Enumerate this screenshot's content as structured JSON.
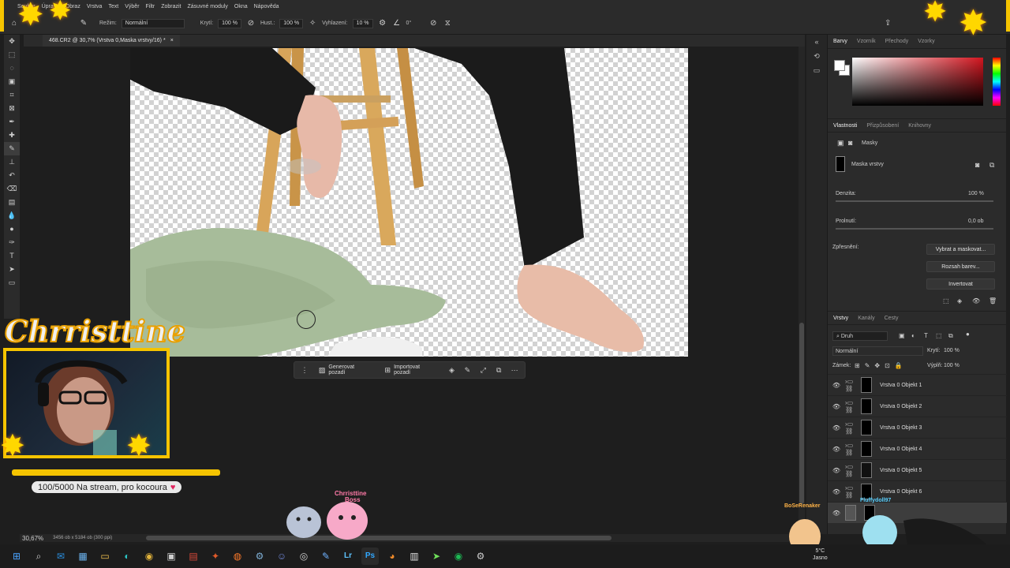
{
  "menu": [
    "Soubor",
    "Úpravy",
    "Obraz",
    "Vrstva",
    "Text",
    "Výběr",
    "Filtr",
    "Zobrazit",
    "Zásuvné moduly",
    "Okna",
    "Nápověda"
  ],
  "options": {
    "mode_label": "Režim:",
    "mode_value": "Normální",
    "opacity_label": "Krytí:",
    "opacity_value": "100 %",
    "flow_label": "Hust.:",
    "flow_value": "100 %",
    "smoothing_label": "Vyhlazení:",
    "smoothing_value": "10 %",
    "angle_value": "0°"
  },
  "document": {
    "tab_title": "468.CR2 @ 30,7% (Vrstva 0,Maska vrstvy/16) *",
    "close": "×",
    "zoom": "30,67%",
    "dims": "3456 ob x 5184 ob (300 ppi)"
  },
  "contextbar": {
    "generate": "Generovat pozadí",
    "import": "Importovat pozadí"
  },
  "color_panel": {
    "tabs": [
      "Barvy",
      "Vzorník",
      "Přechody",
      "Vzorky"
    ],
    "active": "Barvy"
  },
  "properties": {
    "tabs": [
      "Vlastnosti",
      "Přizpůsobení",
      "Knihovny"
    ],
    "section": "Masky",
    "mask_label": "Maska vrstvy",
    "density_label": "Denzita:",
    "density_value": "100 %",
    "feather_label": "Prolnutí:",
    "feather_value": "0,0 ob",
    "refine_label": "Zpřesnění:",
    "btn_select_mask": "Vybrat a maskovat...",
    "btn_color_range": "Rozsah barev...",
    "btn_invert": "Invertovat"
  },
  "layers": {
    "tabs": [
      "Vrstvy",
      "Kanály",
      "Cesty"
    ],
    "filter_value": "Druh",
    "blend_value": "Normální",
    "opacity_label": "Krytí:",
    "opacity_value": "100 %",
    "lock_label": "Zámek:",
    "fill_label": "Výplň:",
    "fill_value": "100 %",
    "items": [
      {
        "name": "Vrstva 0 Objekt 1"
      },
      {
        "name": "Vrstva 0 Objekt 2"
      },
      {
        "name": "Vrstva 0 Objekt 3"
      },
      {
        "name": "Vrstva 0 Objekt 4"
      },
      {
        "name": "Vrstva 0 Objekt 5"
      },
      {
        "name": "Vrstva 0 Objekt 6"
      }
    ]
  },
  "stream": {
    "title": "Chrristtine",
    "goal_text": "100/5000 Na stream, pro kocoura",
    "goal_current": 100,
    "goal_target": 5000,
    "pet1_name": "Chrristtine",
    "pet1_sub": "Boss",
    "pet2_name": "BoSeRenaker",
    "pet3_name": "Fluffydoll97"
  },
  "weather": {
    "temp": "5°C",
    "desc": "Jasno"
  },
  "colors": {
    "accent": "#f5c400",
    "panel_bg": "#2b2b2b",
    "canvas_bg": "#1e1e1e"
  }
}
